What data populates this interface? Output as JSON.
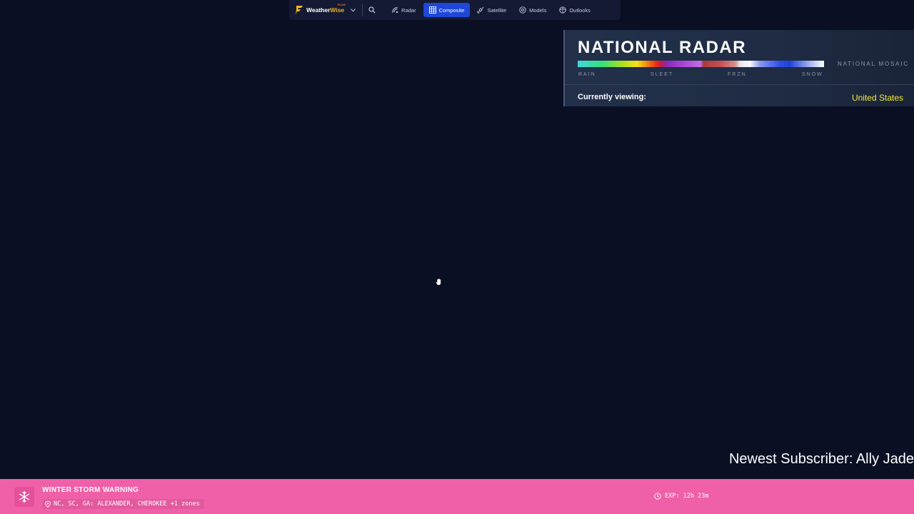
{
  "nav": {
    "brand": {
      "name_part1": "Weather",
      "name_part2": "Wise",
      "tier": "PLUS"
    },
    "items": [
      {
        "label": "Radar",
        "icon": "radar-icon",
        "active": false
      },
      {
        "label": "Composite",
        "icon": "grid-icon",
        "active": true
      },
      {
        "label": "Satellite",
        "icon": "satellite-icon",
        "active": false
      },
      {
        "label": "Models",
        "icon": "models-icon",
        "active": false
      },
      {
        "label": "Outlooks",
        "icon": "outlooks-icon",
        "active": false
      }
    ]
  },
  "radar_panel": {
    "title": "NATIONAL RADAR",
    "mosaic_label": "NATIONAL MOSAIC",
    "scale_labels": {
      "rain": "RAIN",
      "sleet": "SLEET",
      "frzn": "FRZN",
      "snow": "SNOW"
    },
    "viewing_label": "Currently viewing:",
    "viewing_value": "United States"
  },
  "subscriber": "Newest Subscriber: Ally Jade",
  "alert": {
    "title": "WINTER STORM WARNING",
    "areas": "NC, SC, GA: ALEXANDER, CHEROKEE +1 zones",
    "expiry": "EXP: 12h 23m",
    "icon": "snowflake-icon"
  },
  "colors": {
    "background": "#0b0f24",
    "accent": "#1f47d8",
    "alert": "#f060a8",
    "highlight": "#f5ec3a"
  }
}
